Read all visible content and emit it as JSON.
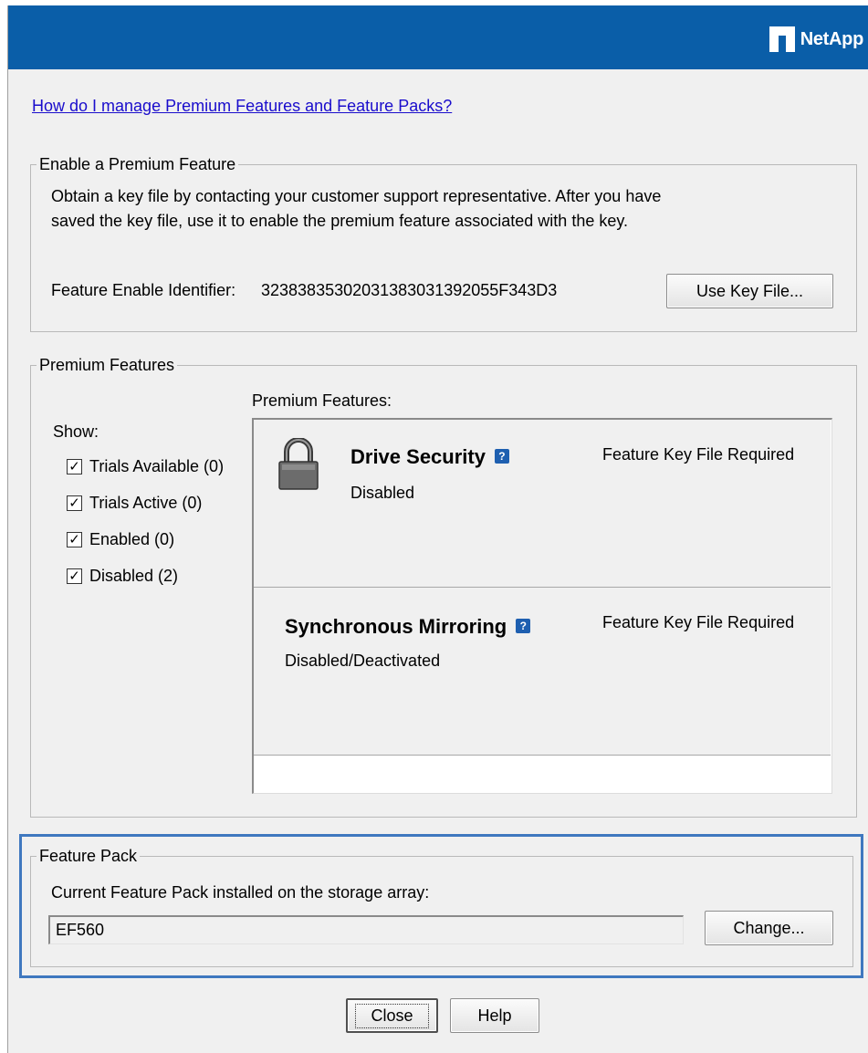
{
  "banner": {
    "logo_text": "NetApp"
  },
  "help_link": "How do I manage Premium Features and Feature Packs?",
  "enable_section": {
    "legend": "Enable a Premium Feature",
    "description": "Obtain a key file by contacting your customer support representative. After you have saved the key file, use it to enable the premium feature associated with the key.",
    "identifier_label": "Feature Enable Identifier:",
    "identifier_value": "32383835302031383031392055F343D3",
    "use_key_button": "Use Key File..."
  },
  "premium_section": {
    "legend": "Premium Features",
    "list_label": "Premium Features:",
    "show_label": "Show:",
    "filters": [
      {
        "label": "Trials Available (0)",
        "checked": true
      },
      {
        "label": "Trials Active (0)",
        "checked": true
      },
      {
        "label": "Enabled (0)",
        "checked": true
      },
      {
        "label": "Disabled (2)",
        "checked": true
      }
    ],
    "features": [
      {
        "name": "Drive Security",
        "status": "Disabled",
        "key": "Feature Key File Required",
        "icon": "lock-icon"
      },
      {
        "name": "Synchronous Mirroring",
        "status": "Disabled/Deactivated",
        "key": "Feature Key File Required",
        "icon": ""
      }
    ],
    "check_glyph": "☑"
  },
  "pack_section": {
    "legend": "Feature Pack",
    "description": "Current Feature Pack installed on the storage array:",
    "value": "EF560",
    "change_button": "Change..."
  },
  "footer": {
    "close_button": "Close",
    "help_button": "Help"
  },
  "colors": {
    "banner": "#0a5ea8",
    "highlight": "#3f78bf",
    "link": "#1a0dcc"
  }
}
